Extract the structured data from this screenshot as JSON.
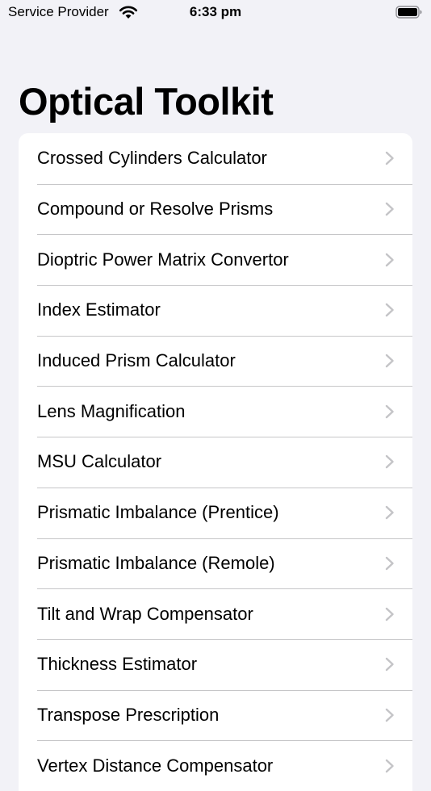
{
  "status_bar": {
    "carrier": "Service Provider",
    "time": "6:33 pm",
    "icons": [
      "wifi-icon",
      "battery-icon"
    ]
  },
  "page": {
    "title": "Optical Toolkit"
  },
  "menu": {
    "items": [
      {
        "label": "Crossed Cylinders Calculator"
      },
      {
        "label": "Compound or Resolve Prisms"
      },
      {
        "label": "Dioptric Power Matrix Convertor"
      },
      {
        "label": "Index Estimator"
      },
      {
        "label": "Induced Prism Calculator"
      },
      {
        "label": "Lens Magnification"
      },
      {
        "label": "MSU Calculator"
      },
      {
        "label": "Prismatic Imbalance (Prentice)"
      },
      {
        "label": "Prismatic Imbalance (Remole)"
      },
      {
        "label": "Tilt and Wrap Compensator"
      },
      {
        "label": "Thickness Estimator"
      },
      {
        "label": "Transpose Prescription"
      },
      {
        "label": "Vertex Distance Compensator"
      }
    ]
  },
  "colors": {
    "background": "#f2f2f7",
    "list_background": "#ffffff",
    "separator": "#c6c6c8",
    "chevron": "#c4c4c7"
  }
}
